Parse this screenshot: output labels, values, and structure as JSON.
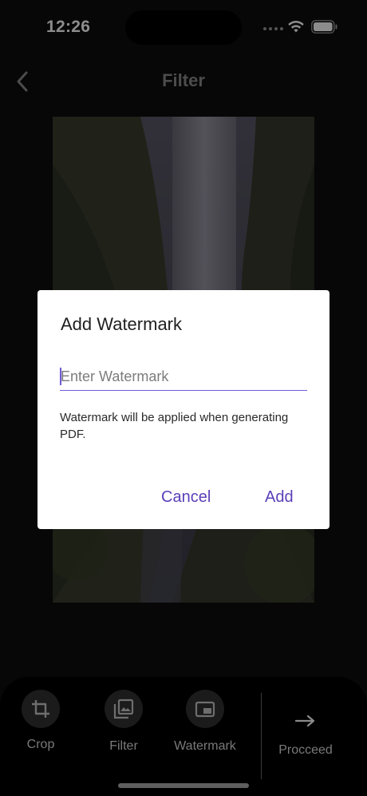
{
  "status": {
    "time": "12:26"
  },
  "header": {
    "title": "Filter"
  },
  "dialog": {
    "title": "Add Watermark",
    "input_placeholder": "Enter Watermark",
    "input_value": "",
    "helper": "Watermark will be applied when generating PDF.",
    "cancel_label": "Cancel",
    "add_label": "Add"
  },
  "toolbar": {
    "crop_label": "Crop",
    "filter_label": "Filter",
    "watermark_label": "Watermark",
    "proceed_label": "Procceed"
  },
  "icons": {
    "back": "chevron-left-icon",
    "crop": "crop-icon",
    "filter": "image-icon",
    "watermark": "watermark-icon",
    "proceed": "arrow-right-icon"
  },
  "colors": {
    "accent": "#5b3fb8",
    "input_underline": "#6f5bd6",
    "background": "#0e0e0e"
  }
}
